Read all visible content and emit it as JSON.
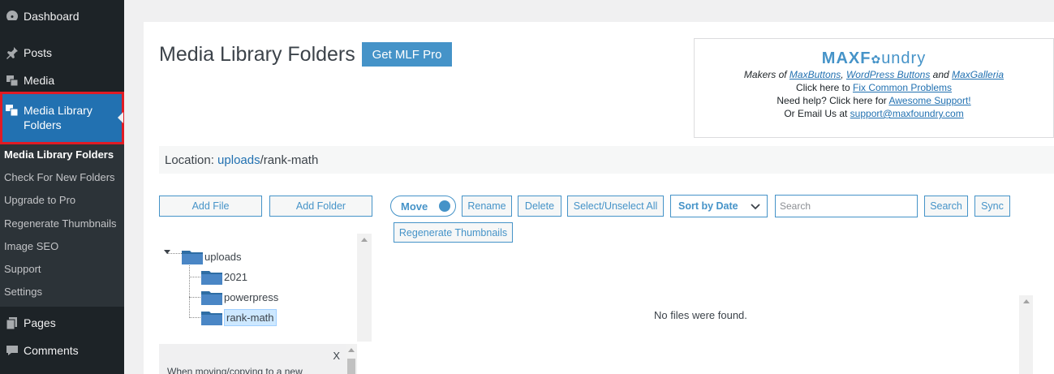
{
  "sidebar": {
    "items": [
      {
        "label": "Dashboard",
        "icon": "dashboard-icon"
      },
      {
        "label": "Posts",
        "icon": "pin-icon"
      },
      {
        "label": "Media",
        "icon": "media-icon"
      },
      {
        "label": "Media Library Folders",
        "icon": "media-folders-icon"
      },
      {
        "label": "Pages",
        "icon": "pages-icon"
      },
      {
        "label": "Comments",
        "icon": "comments-icon"
      }
    ],
    "submenu": [
      "Media Library Folders",
      "Check For New Folders",
      "Upgrade to Pro",
      "Regenerate Thumbnails",
      "Image SEO",
      "Support",
      "Settings"
    ]
  },
  "header": {
    "title": "Media Library Folders",
    "pro_button": "Get MLF Pro"
  },
  "promo": {
    "logo_bold": "MAXF",
    "logo_rest": "undry",
    "makers_prefix": "Makers of ",
    "link_maxbuttons": "MaxButtons",
    "comma": ", ",
    "link_wpbuttons": "WordPress Buttons",
    "and": " and ",
    "link_maxgalleria": "MaxGalleria",
    "fix_prefix": "Click here to ",
    "link_fix": "Fix Common Problems",
    "help_prefix": "Need help? Click here for ",
    "link_support": "Awesome Support!",
    "email_prefix": "Or Email Us at ",
    "link_email": "support@maxfoundry.com"
  },
  "location": {
    "label": "Location: ",
    "root": "uploads",
    "path": "/rank-math"
  },
  "toolbar": {
    "add_file": "Add File",
    "add_folder": "Add Folder",
    "move": "Move",
    "rename": "Rename",
    "delete": "Delete",
    "select_all": "Select/Unselect All",
    "sort": "Sort by Date",
    "search_placeholder": "Search",
    "search": "Search",
    "sync": "Sync",
    "regen": "Regenerate Thumbnails"
  },
  "tree": {
    "root": "uploads",
    "children": [
      "2021",
      "powerpress",
      "rank-math"
    ],
    "selected": "rank-math"
  },
  "notice": {
    "close": "X",
    "text": "When moving/copying to a new"
  },
  "files": {
    "empty": "No files were found."
  },
  "colors": {
    "sidebar_bg": "#1d2327",
    "accent": "#2271b1",
    "button_blue": "#4593c8",
    "highlight_border": "#e01b24"
  }
}
